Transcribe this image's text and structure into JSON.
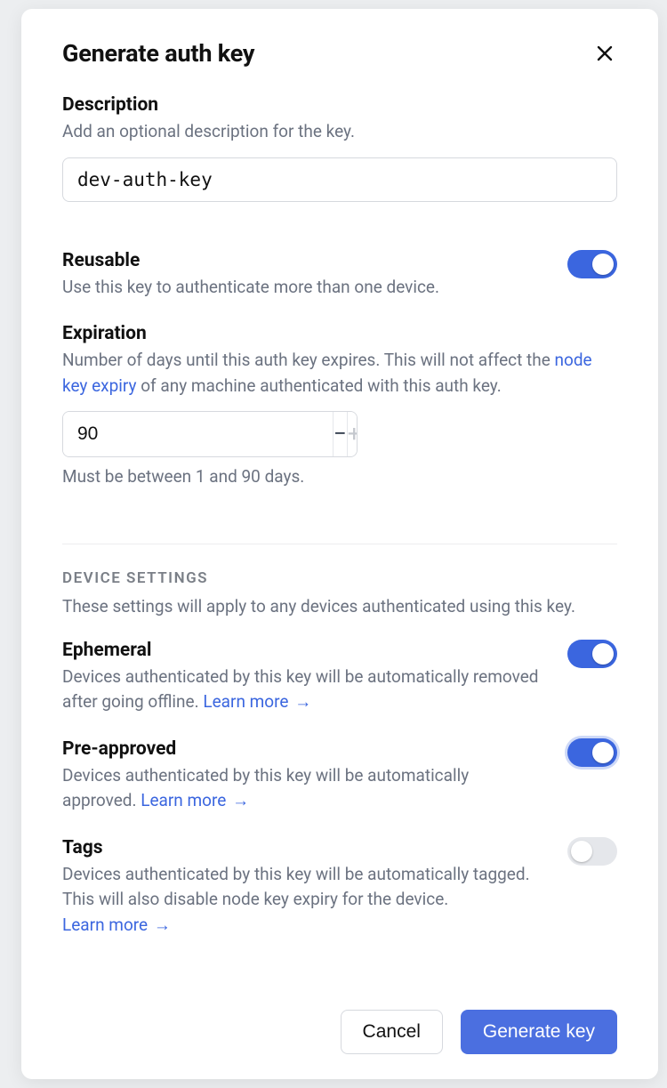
{
  "modal": {
    "title": "Generate auth key"
  },
  "description": {
    "title": "Description",
    "help": "Add an optional description for the key.",
    "value": "dev-auth-key"
  },
  "reusable": {
    "title": "Reusable",
    "help": "Use this key to authenticate more than one device.",
    "enabled": true
  },
  "expiration": {
    "title": "Expiration",
    "help_prefix": "Number of days until this auth key expires. This will not affect the ",
    "link_text": "node key expiry",
    "help_suffix": " of any machine authenticated with this auth key.",
    "value": "90",
    "unit": "days",
    "constraint": "Must be between 1 and 90 days."
  },
  "device_settings": {
    "heading": "DEVICE SETTINGS",
    "help": "These settings will apply to any devices authenticated using this key."
  },
  "ephemeral": {
    "title": "Ephemeral",
    "help": "Devices authenticated by this key will be automatically removed after going offline. ",
    "learn_more": "Learn more",
    "enabled": true
  },
  "preapproved": {
    "title": "Pre-approved",
    "help": "Devices authenticated by this key will be automatically approved. ",
    "learn_more": "Learn more",
    "enabled": true
  },
  "tags": {
    "title": "Tags",
    "help": "Devices authenticated by this key will be automatically tagged. This will also disable node key expiry for the device. ",
    "learn_more": "Learn more",
    "enabled": false
  },
  "footer": {
    "cancel": "Cancel",
    "submit": "Generate key"
  },
  "glyphs": {
    "arrow": "→"
  }
}
